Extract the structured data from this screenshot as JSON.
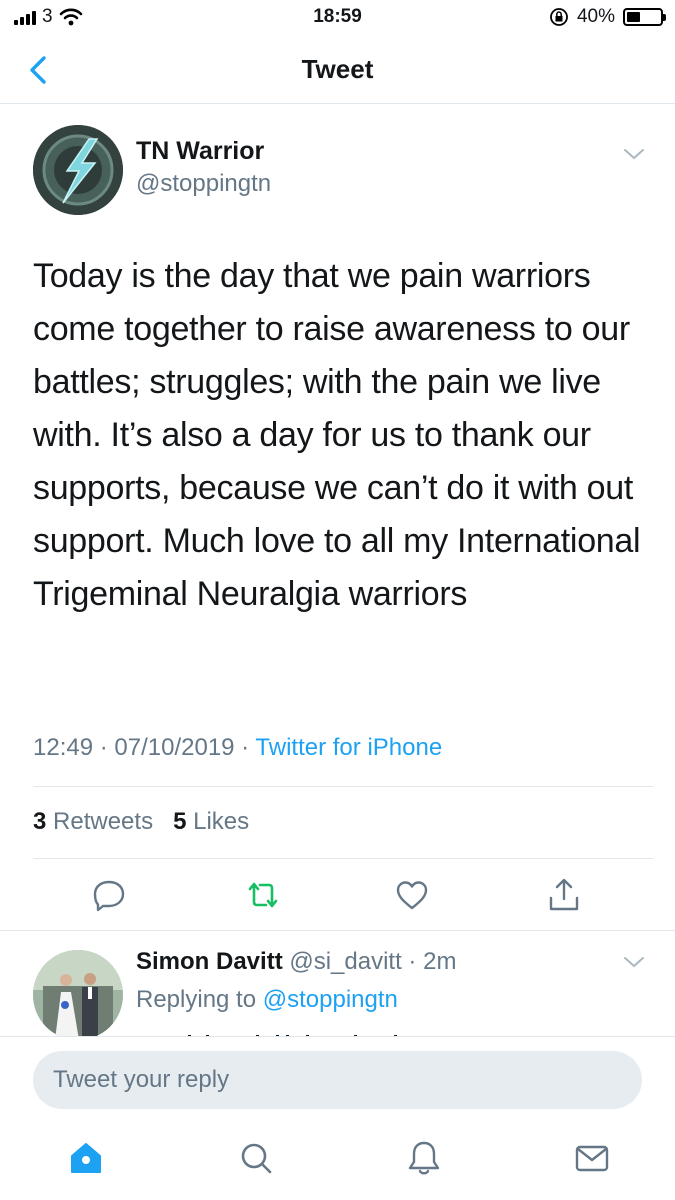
{
  "status_bar": {
    "carrier": "3",
    "time": "18:59",
    "battery": "40%",
    "battery_level": 0.4
  },
  "nav": {
    "title": "Tweet",
    "back_icon": "chevron-left-icon"
  },
  "tweet": {
    "author_name": "TN Warrior",
    "author_handle": "@stoppingtn",
    "text": "Today is the day that we pain warriors come together to raise awareness to our battles; struggles; with the pain we live with. It’s also a day for us to thank our supports, because we can’t do it with out support. Much love to all my International Trigeminal Neuralgia warriors",
    "time": "12:49",
    "date": "07/10/2019",
    "separator": " · ",
    "source": "Twitter for iPhone",
    "retweets_count": "3",
    "retweets_label": "Retweets",
    "likes_count": "5",
    "likes_label": "Likes",
    "actions": [
      "reply-icon",
      "retweet-icon",
      "like-icon",
      "share-icon"
    ]
  },
  "reply": {
    "name": "Simon Davitt",
    "handle": "@si_davitt",
    "age": "2m",
    "replying_label": "Replying to",
    "replying_mention": "@stoppingtn"
  },
  "compose": {
    "placeholder": "Tweet your reply"
  },
  "tab_bar": [
    "home-icon",
    "search-icon",
    "notifications-icon",
    "messages-icon"
  ],
  "colors": {
    "accent": "#1da1f2",
    "retweet": "#17bf63",
    "muted": "#657786",
    "text": "#14171a"
  }
}
